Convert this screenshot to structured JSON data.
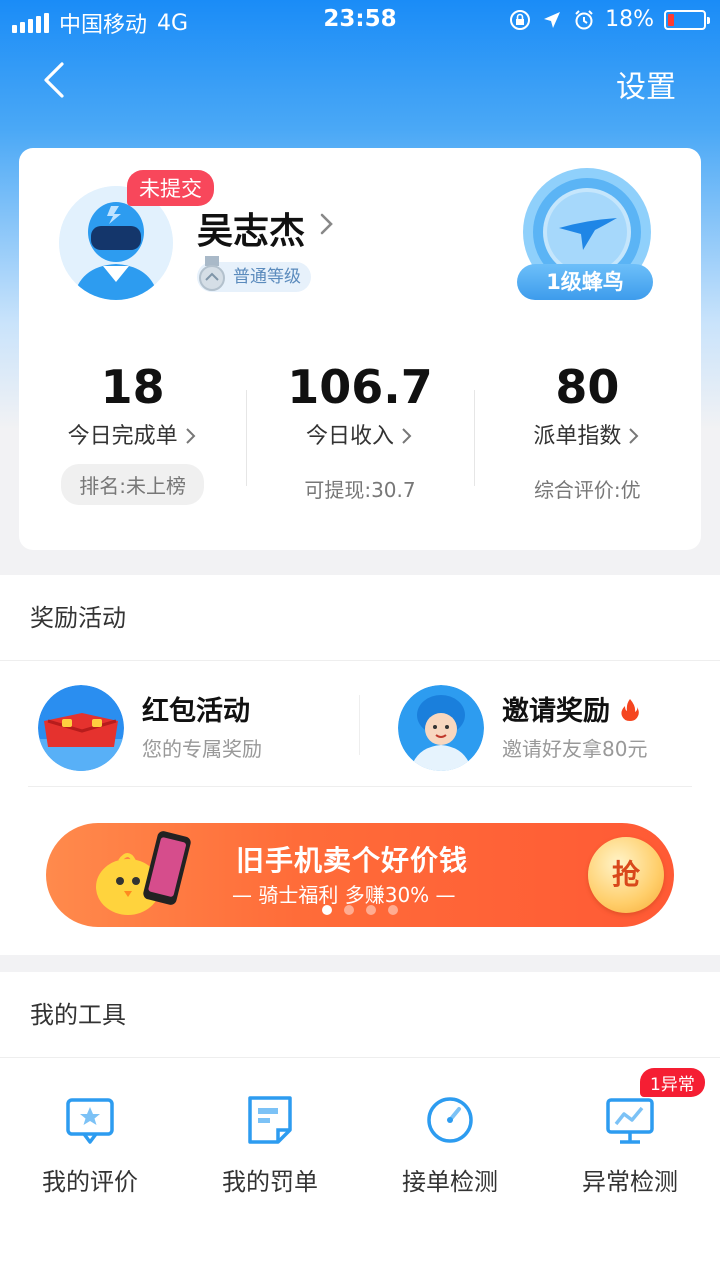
{
  "status_bar": {
    "carrier": "中国移动",
    "network": "4G",
    "time": "23:58",
    "battery_percent": "18%",
    "battery_level": 0.18
  },
  "nav": {
    "settings_label": "设置"
  },
  "profile": {
    "badge": "未提交",
    "name": "吴志杰",
    "level": "普通等级",
    "rank": "1级蜂鸟"
  },
  "stats": [
    {
      "value": "18",
      "label": "今日完成单",
      "sub": "排名:未上榜"
    },
    {
      "value": "106.7",
      "label": "今日收入",
      "sub": "可提现:30.7"
    },
    {
      "value": "80",
      "label": "派单指数",
      "sub": "综合评价:优"
    }
  ],
  "rewards": {
    "title": "奖励活动",
    "items": [
      {
        "title": "红包活动",
        "desc": "您的专属奖励"
      },
      {
        "title": "邀请奖励",
        "desc": "邀请好友拿80元"
      }
    ],
    "banner": {
      "title": "旧手机卖个好价钱",
      "subtitle": "— 骑士福利  多赚30% —",
      "grab_label": "抢"
    }
  },
  "tools": {
    "title": "我的工具",
    "items": [
      {
        "label": "我的评价",
        "icon": "review-star-icon"
      },
      {
        "label": "我的罚单",
        "icon": "penalty-note-icon"
      },
      {
        "label": "接单检测",
        "icon": "gauge-icon"
      },
      {
        "label": "异常检测",
        "icon": "monitor-chart-icon",
        "badge": "1异常"
      }
    ]
  },
  "colors": {
    "primary_blue": "#1a8cf7",
    "badge_red": "#f8475b",
    "banner_orange": "#ff6c39",
    "icon_blue": "#2d9cf0"
  }
}
